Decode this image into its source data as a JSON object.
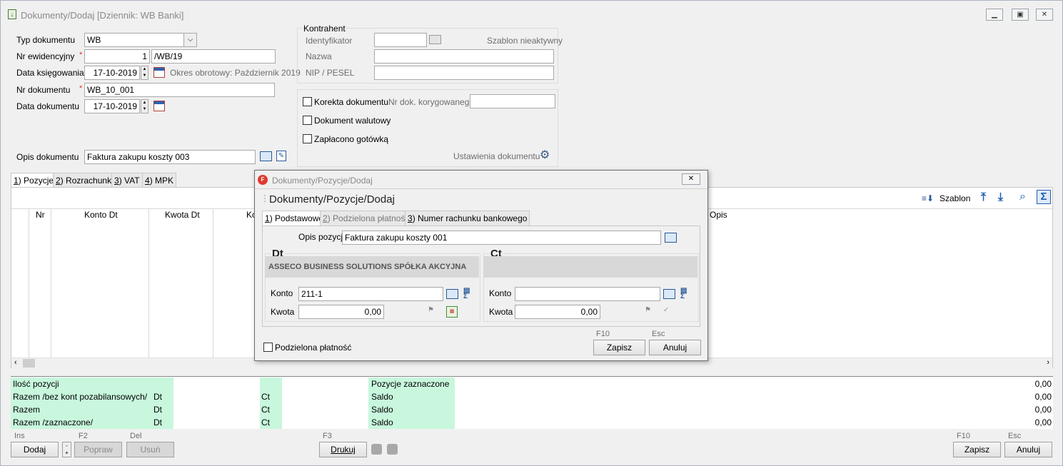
{
  "window": {
    "title": "Dokumenty/Dodaj [Dziennik: WB  Banki]"
  },
  "header": {
    "typ_dokumentu_label": "Typ dokumentu",
    "typ_dokumentu_value": "WB",
    "nr_ewidencyjny_label": "Nr ewidencyjny",
    "nr_ewidencyjny_number": "1",
    "nr_ewidencyjny_suffix": "/WB/19",
    "data_ksiegowania_label": "Data księgowania",
    "data_ksiegowania_value": "17-10-2019",
    "okres_obrotowy": "Okres obrotowy: Październik 2019",
    "nr_dokumentu_label": "Nr dokumentu",
    "nr_dokumentu_value": "WB_10_001",
    "data_dokumentu_label": "Data dokumentu",
    "data_dokumentu_value": "17-10-2019",
    "opis_dokumentu_label": "Opis dokumentu",
    "opis_dokumentu_value": "Faktura zakupu koszty 003",
    "required_mark": "*"
  },
  "kontrahent": {
    "group_title": "Kontrahent",
    "identyfikator_label": "Identyfikator",
    "szablon_status": "Szablon nieaktywny",
    "nazwa_label": "Nazwa",
    "nip_label": "NIP / PESEL"
  },
  "options": {
    "korekta_label": "Korekta dokumentu",
    "nr_dok_korygowanego_label": "Nr dok. korygowanego",
    "walutowy_label": "Dokument walutowy",
    "gotowka_label": "Zapłacono gotówką",
    "ustawienia_label": "Ustawienia dokumentu"
  },
  "tabs": [
    {
      "key": "1",
      "label": "Pozycje"
    },
    {
      "key": "2",
      "label": "Rozrachunki"
    },
    {
      "key": "3",
      "label": "VAT"
    },
    {
      "key": "4",
      "label": "MPK"
    }
  ],
  "grid": {
    "toolbar_szablon": "Szablon",
    "columns": [
      "Nr",
      "Konto Dt",
      "Kwota Dt",
      "Ko",
      "Opis"
    ]
  },
  "summary": {
    "rows": [
      {
        "label": "Ilość pozycji",
        "dt": "",
        "ct": "",
        "right_label": "Pozycje zaznaczone",
        "value": "0,00"
      },
      {
        "label": "Razem /bez kont pozabilansowych/",
        "dt": "Dt",
        "ct": "Ct",
        "right_label": "Saldo",
        "value": "0,00"
      },
      {
        "label": "Razem",
        "dt": "Dt",
        "ct": "Ct",
        "right_label": "Saldo",
        "value": "0,00"
      },
      {
        "label": "Razem /zaznaczone/",
        "dt": "Dt",
        "ct": "Ct",
        "right_label": "Saldo",
        "value": "0,00"
      }
    ]
  },
  "footer": {
    "ins_key": "Ins",
    "dodaj_label": "Dodaj",
    "f2_key": "F2",
    "popraw_label": "Popraw",
    "del_key": "Del",
    "usun_label": "Usuń",
    "f3_key": "F3",
    "drukuj_label": "Drukuj",
    "f10_key": "F10",
    "zapisz_label": "Zapisz",
    "esc_key": "Esc",
    "anuluj_label": "Anuluj"
  },
  "dialog": {
    "title": "Dokumenty/Pozycje/Dodaj",
    "heading": "Dokumenty/Pozycje/Dodaj",
    "tabs": [
      {
        "key": "1",
        "label": "Podstawowe"
      },
      {
        "key": "2",
        "label": "Podzielona płatność"
      },
      {
        "key": "3",
        "label": "Numer rachunku bankowego"
      }
    ],
    "opis_pozycji_label": "Opis pozycji",
    "opis_pozycji_value": "Faktura zakupu koszty 001",
    "dt": {
      "title": "Dt",
      "kontrahent_name": "ASSECO BUSINESS SOLUTIONS SPÓŁKA AKCYJNA",
      "konto_label": "Konto",
      "konto_value": "211-1",
      "kwota_label": "Kwota",
      "kwota_value": "0,00"
    },
    "ct": {
      "title": "Ct",
      "kontrahent_name": "",
      "konto_label": "Konto",
      "konto_value": "",
      "kwota_label": "Kwota",
      "kwota_value": "0,00"
    },
    "podzielona_label": "Podzielona płatność",
    "f10_key": "F10",
    "zapisz_label": "Zapisz",
    "esc_key": "Esc",
    "anuluj_label": "Anuluj"
  }
}
